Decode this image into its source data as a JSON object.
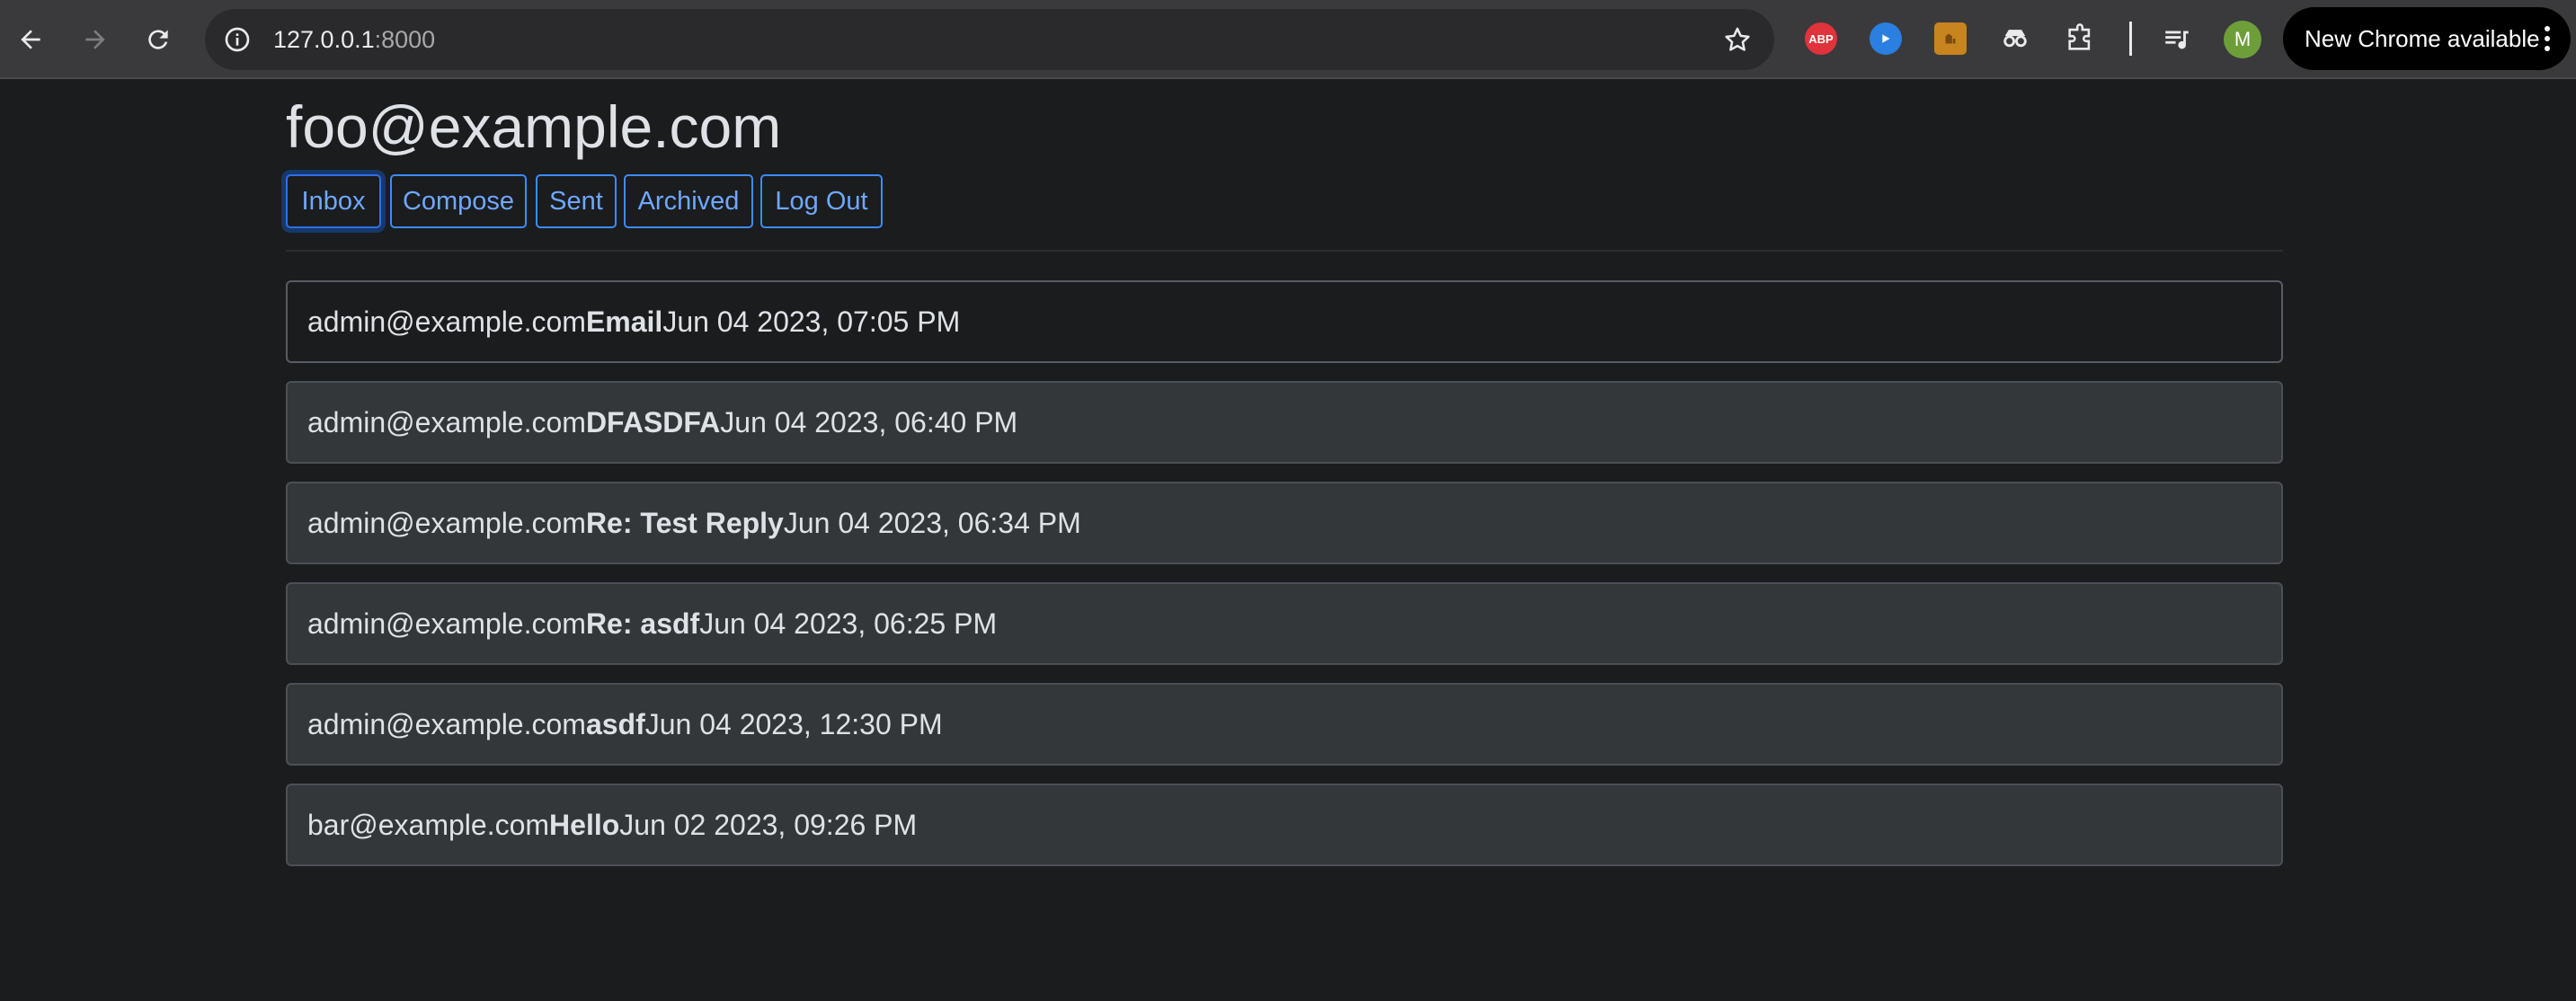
{
  "browser": {
    "url_host": "127.0.0.1",
    "url_port": ":8000",
    "ext_abp_label": "ABP",
    "avatar_initial": "M",
    "update_label": "New Chrome available"
  },
  "page": {
    "user_email": "foo@example.com"
  },
  "nav": [
    {
      "label": "Inbox",
      "active": true
    },
    {
      "label": "Compose"
    },
    {
      "label": "Sent"
    },
    {
      "label": "Archived"
    },
    {
      "label": "Log Out"
    }
  ],
  "emails": [
    {
      "sender": "admin@example.com",
      "subject": "Email",
      "timestamp": "Jun 04 2023, 07:05 PM",
      "read": false
    },
    {
      "sender": "admin@example.com",
      "subject": "DFASDFA",
      "timestamp": "Jun 04 2023, 06:40 PM",
      "read": true
    },
    {
      "sender": "admin@example.com",
      "subject": "Re: Test Reply",
      "timestamp": "Jun 04 2023, 06:34 PM",
      "read": true
    },
    {
      "sender": "admin@example.com",
      "subject": "Re: asdf",
      "timestamp": "Jun 04 2023, 06:25 PM",
      "read": true
    },
    {
      "sender": "admin@example.com",
      "subject": "asdf",
      "timestamp": "Jun 04 2023, 12:30 PM",
      "read": true
    },
    {
      "sender": "bar@example.com",
      "subject": "Hello",
      "timestamp": "Jun 02 2023, 09:26 PM",
      "read": true
    }
  ],
  "colors": {
    "page_bg": "#1b1c1e",
    "button_border": "#3d8bfd",
    "button_text": "#6ea8fe",
    "read_row_bg": "#34373a"
  }
}
